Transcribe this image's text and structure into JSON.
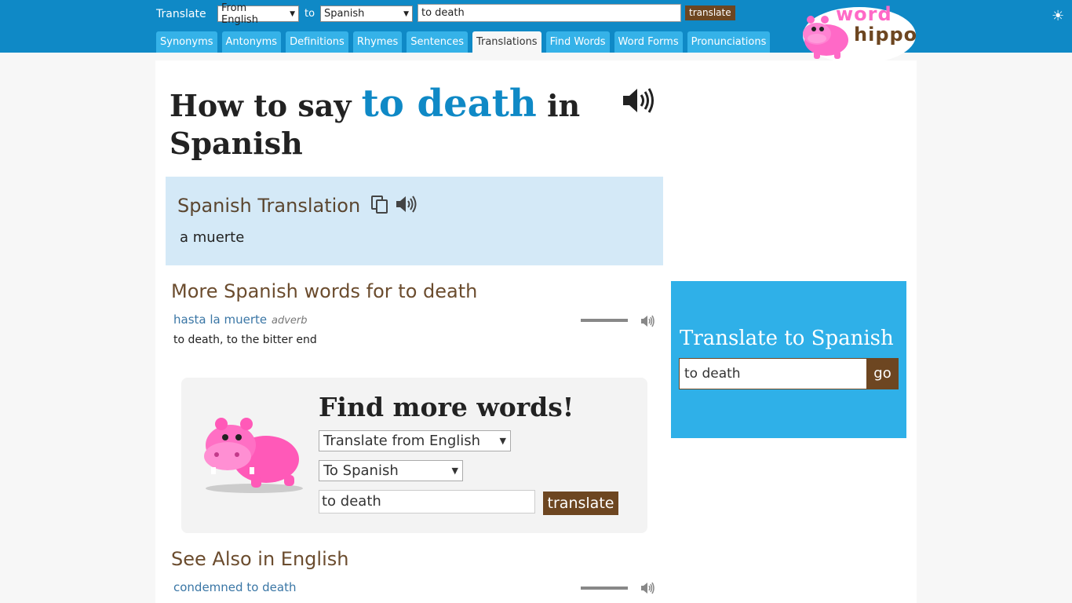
{
  "header": {
    "translate_label": "Translate",
    "from_language": "From English",
    "to_label": "to",
    "to_language": "Spanish",
    "search_value": "to death",
    "translate_button": "translate",
    "tabs": [
      {
        "label": "Synonyms"
      },
      {
        "label": "Antonyms"
      },
      {
        "label": "Definitions"
      },
      {
        "label": "Rhymes"
      },
      {
        "label": "Sentences"
      },
      {
        "label": "Translations",
        "active": true
      },
      {
        "label": "Find Words"
      },
      {
        "label": "Word Forms"
      },
      {
        "label": "Pronunciations"
      }
    ],
    "logo": {
      "word": "word",
      "hippo": "hippo"
    },
    "theme_icon": "sun-icon"
  },
  "main": {
    "title_prefix": "How to say",
    "title_term": "to death",
    "title_suffix": "in",
    "title_language": "Spanish",
    "translation_box": {
      "title": "Spanish Translation",
      "text": "a muerte"
    },
    "more_words": {
      "title": "More Spanish words for to death",
      "items": [
        {
          "word": "hasta la muerte",
          "pos": "adverb",
          "definition": "to death, to the bitter end"
        }
      ]
    },
    "find_more": {
      "title": "Find more words!",
      "from_select": "Translate from English",
      "to_select": "To Spanish",
      "input_value": "to death",
      "button": "translate"
    },
    "see_also": {
      "title": "See Also in English",
      "items": [
        {
          "word": "condemned to death"
        }
      ]
    }
  },
  "sidebar": {
    "title": "Translate to Spanish",
    "input_value": "to death",
    "button": "go"
  },
  "colors": {
    "header_blue": "#0f89c6",
    "tab_blue": "#35b2e8",
    "brand_brown": "#6d4621",
    "hippo_pink": "#ff69c7",
    "translation_bg": "#d4e9f7"
  }
}
